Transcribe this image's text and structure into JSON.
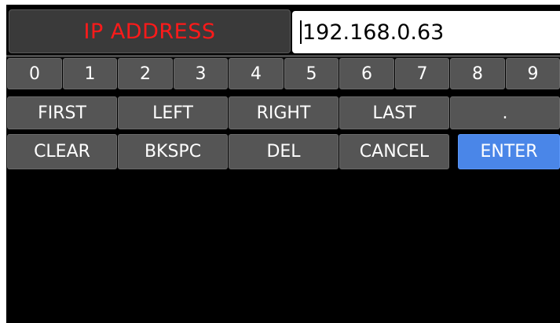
{
  "field": {
    "label": "IP ADDRESS",
    "value": "192.168.0.63"
  },
  "keypad": {
    "digits": [
      "0",
      "1",
      "2",
      "3",
      "4",
      "5",
      "6",
      "7",
      "8",
      "9"
    ],
    "nav": {
      "first": "FIRST",
      "left": "LEFT",
      "right": "RIGHT",
      "last": "LAST",
      "dot": "."
    },
    "actions": {
      "clear": "CLEAR",
      "bkspc": "BKSPC",
      "del": "DEL",
      "cancel": "CANCEL",
      "enter": "ENTER"
    }
  },
  "colors": {
    "label_text": "#ff1a1a",
    "key_bg": "#555555",
    "enter_bg": "#4a86e8",
    "screen_bg": "#000000"
  }
}
